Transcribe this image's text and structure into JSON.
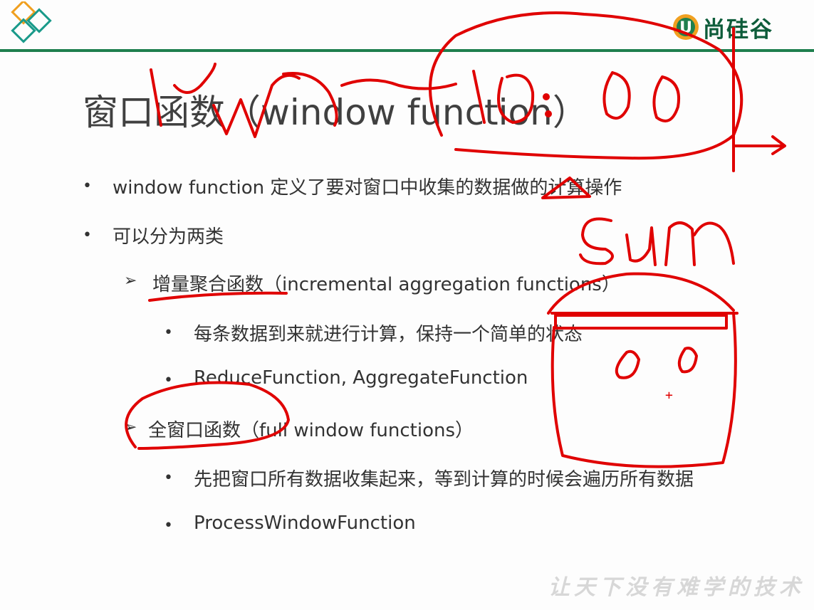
{
  "slide": {
    "title": "窗口函数（window function）",
    "brand": {
      "name": "尚硅谷",
      "mark": "U"
    },
    "bullets": [
      {
        "level": 1,
        "text": "window function 定义了要对窗口中收集的数据做的计算操作"
      },
      {
        "level": 1,
        "text": "可以分为两类"
      },
      {
        "level": 2,
        "text": "增量聚合函数（incremental aggregation functions）"
      },
      {
        "level": 3,
        "text": "每条数据到来就进行计算，保持一个简单的状态"
      },
      {
        "level": 3,
        "text": "ReduceFunction, AggregateFunction"
      },
      {
        "level": 2,
        "text": "全窗口函数（full window functions）"
      },
      {
        "level": 3,
        "text": "先把窗口所有数据收集起来，等到计算的时候会遍历所有数据"
      },
      {
        "level": 3,
        "text": "ProcessWindowFunction"
      }
    ],
    "watermark": "让天下没有难学的技术"
  },
  "colors": {
    "brand_green": "#1f7f4e",
    "ink_red": "#e00000",
    "logo_orange": "#f0a020",
    "logo_teal": "#1a9a8a"
  }
}
